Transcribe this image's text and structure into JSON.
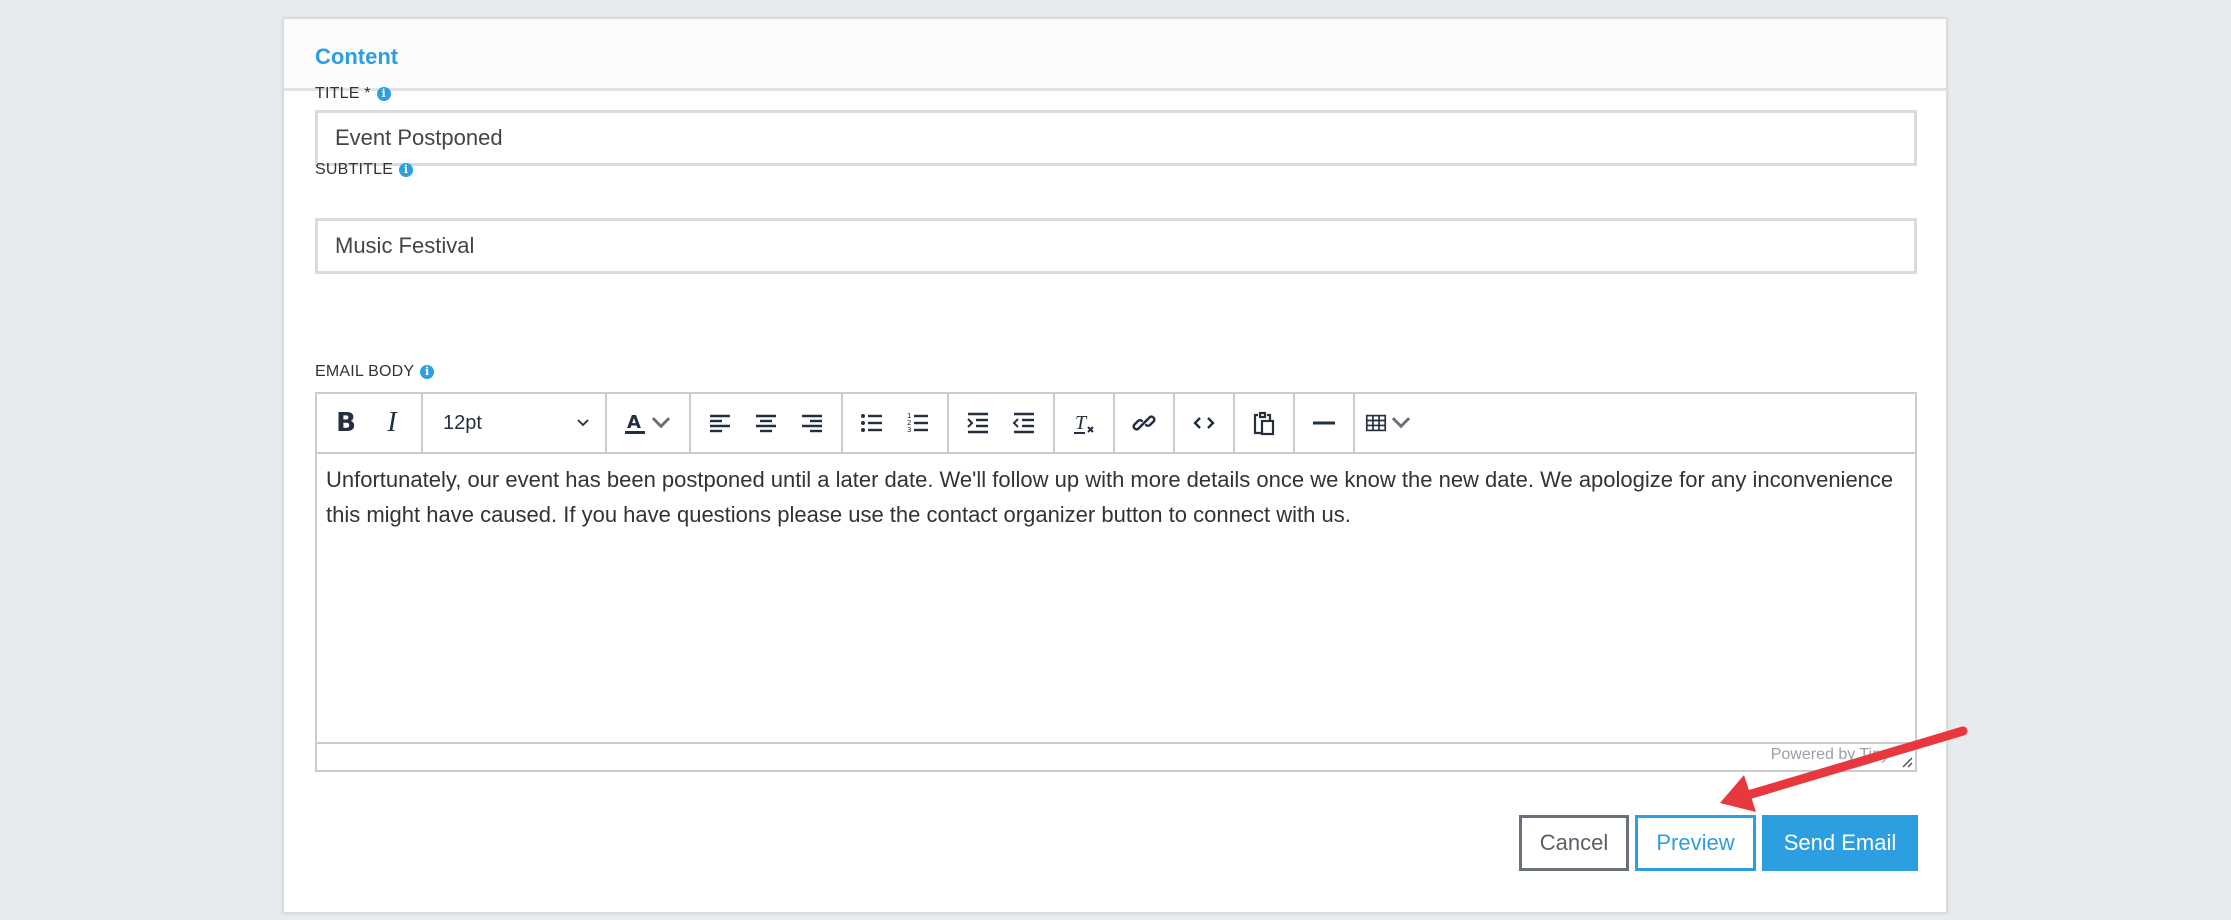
{
  "card": {
    "title": "Content"
  },
  "fields": {
    "title": {
      "label": "TITLE *",
      "value": "Event Postponed",
      "info_icon": "info-icon"
    },
    "subtitle": {
      "label": "SUBTITLE",
      "value": "Music Festival",
      "info_icon": "info-icon"
    },
    "email_body": {
      "label": "EMAIL BODY",
      "info_icon": "info-icon"
    }
  },
  "editor": {
    "toolbar": {
      "bold": "B",
      "italic": "I",
      "font_size": "12pt",
      "icons": [
        "bold-icon",
        "italic-icon",
        "font-size-select",
        "text-color-icon",
        "align-left-icon",
        "align-center-icon",
        "align-right-icon",
        "bullet-list-icon",
        "numbered-list-icon",
        "indent-icon",
        "outdent-icon",
        "clear-formatting-icon",
        "link-icon",
        "code-icon",
        "paste-icon",
        "horizontal-rule-icon",
        "table-icon"
      ]
    },
    "body": "Unfortunately, our event has been postponed until a later date. We'll follow up with more details once we know the new date. We apologize for any inconvenience this might have caused. If you have questions please use the contact organizer button to connect with us.",
    "status": "Powered by Tiny"
  },
  "actions": {
    "cancel": "Cancel",
    "preview": "Preview",
    "send": "Send Email"
  },
  "colors": {
    "accent": "#2d9ee0",
    "annotation_arrow": "#e8383d"
  }
}
